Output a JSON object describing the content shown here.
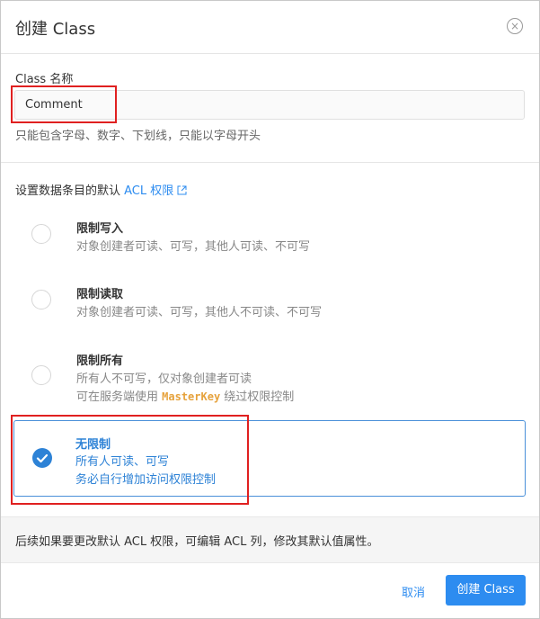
{
  "dialog": {
    "title": "创建 Class",
    "close_glyph": "×"
  },
  "class_name": {
    "label": "Class 名称",
    "value": "Comment",
    "hint": "只能包含字母、数字、下划线，只能以字母开头"
  },
  "acl": {
    "title_prefix": "设置数据条目的默认 ",
    "title_link": "ACL 权限",
    "options": [
      {
        "title": "限制写入",
        "desc": "对象创建者可读、可写，其他人可读、不可写",
        "selected": false
      },
      {
        "title": "限制读取",
        "desc": "对象创建者可读、可写，其他人不可读、不可写",
        "selected": false
      },
      {
        "title": "限制所有",
        "desc": "所有人不可写，仅对象创建者可读",
        "desc2_prefix": "可在服务端使用 ",
        "desc2_code": "MasterKey",
        "desc2_suffix": " 绕过权限控制",
        "selected": false
      },
      {
        "title": "无限制",
        "desc": "所有人可读、可写",
        "desc2": "务必自行增加访问权限控制",
        "selected": true
      }
    ]
  },
  "footer": {
    "note": "后续如果要更改默认 ACL 权限，可编辑 ACL 列，修改其默认值属性。",
    "cancel_label": "取消",
    "create_label": "创建 Class"
  },
  "colors": {
    "accent": "#2d8cf0",
    "selected_border": "#4a90d9",
    "highlight_box": "#e02020",
    "code": "#e6a23c"
  }
}
